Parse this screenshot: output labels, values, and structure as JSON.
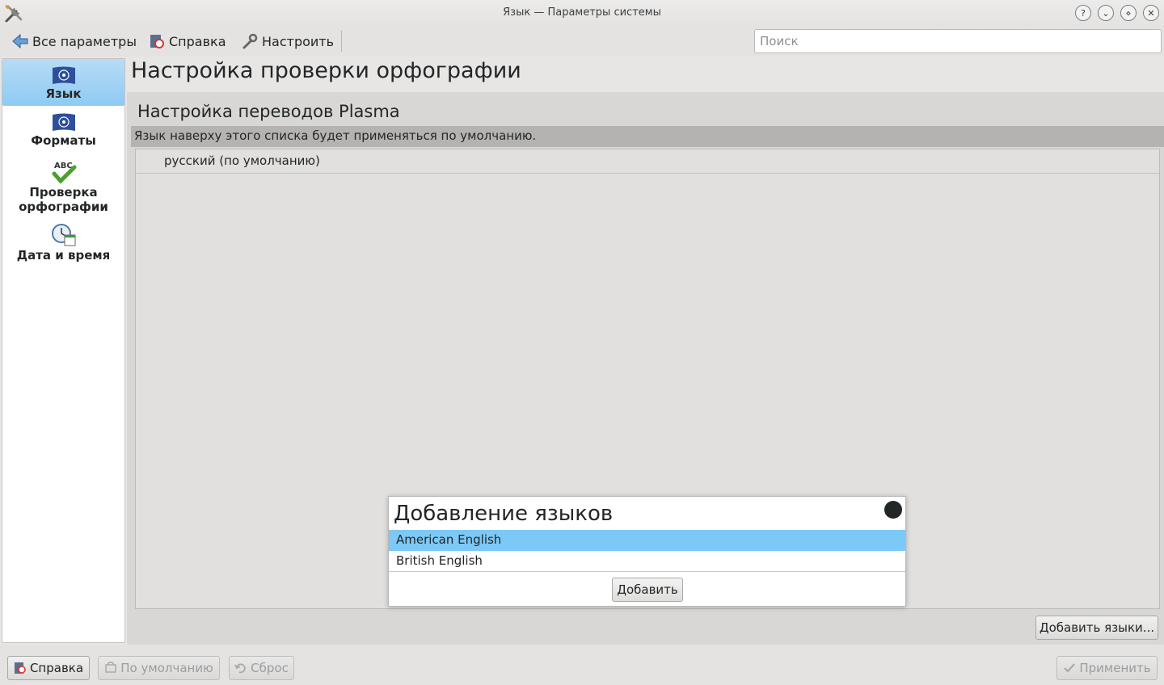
{
  "window": {
    "title": "Язык — Параметры системы",
    "buttons": {
      "help": "?",
      "minimize": "⌄",
      "maximize": "⋄",
      "close": "✕"
    }
  },
  "toolbar": {
    "all_settings": "Все параметры",
    "help": "Справка",
    "configure": "Настроить",
    "search_placeholder": "Поиск"
  },
  "sidebar": {
    "items": [
      {
        "label": "Язык",
        "icon": "un-flag-icon",
        "active": true
      },
      {
        "label": "Форматы",
        "icon": "un-flag-icon",
        "active": false
      },
      {
        "label": "Проверка орфографии",
        "icon": "spellcheck-icon",
        "active": false
      },
      {
        "label": "Дата и время",
        "icon": "clock-calendar-icon",
        "active": false
      }
    ]
  },
  "main": {
    "page_title": "Настройка проверки орфографии",
    "section_title": "Настройка переводов Plasma",
    "hint": "Язык наверху этого списка будет применяться по умолчанию.",
    "languages": [
      "русский (по умолчанию)"
    ],
    "add_languages_button": "Добавить языки..."
  },
  "popup": {
    "title": "Добавление языков",
    "items": [
      {
        "label": "American English",
        "selected": true
      },
      {
        "label": "British English",
        "selected": false
      }
    ],
    "add_button": "Добавить"
  },
  "bottom": {
    "help": "Справка",
    "defaults": "По умолчанию",
    "reset": "Сброс",
    "apply": "Применить"
  },
  "colors": {
    "selection": "#7cc9f7",
    "sidebar_active": "#8fcaf3"
  }
}
